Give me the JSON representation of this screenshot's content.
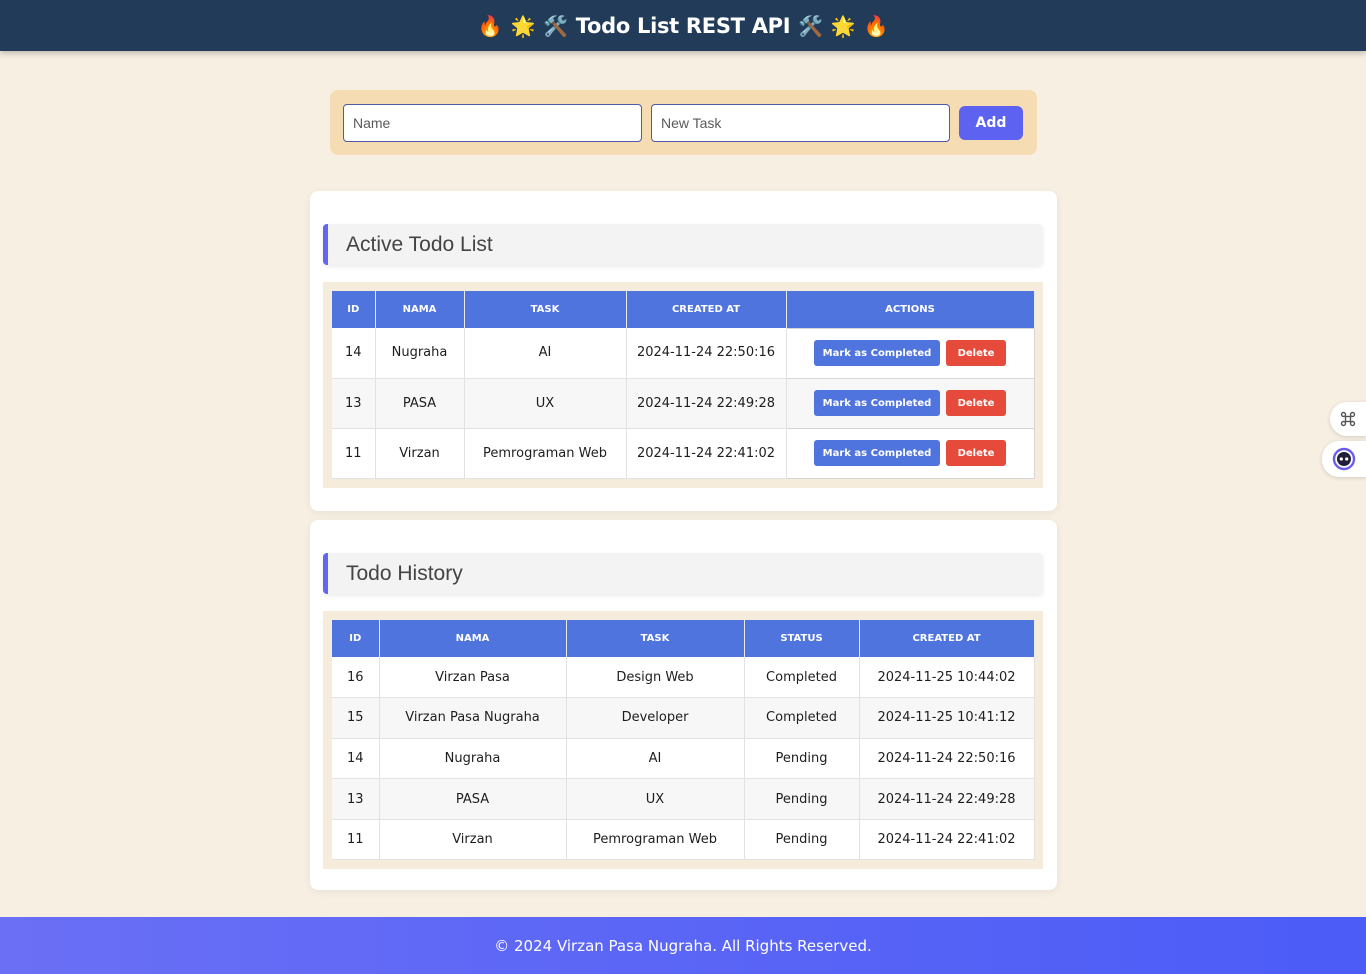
{
  "header": {
    "title": "Todo List REST API",
    "left_emojis": [
      "🔥",
      "🌟",
      "🛠️"
    ],
    "right_emojis": [
      "🛠️",
      "🌟",
      "🔥"
    ]
  },
  "form": {
    "name_placeholder": "Name",
    "task_placeholder": "New Task",
    "add_label": "Add"
  },
  "active": {
    "title": "Active Todo List",
    "columns": [
      "ID",
      "NAMA",
      "TASK",
      "CREATED AT",
      "ACTIONS"
    ],
    "complete_label": "Mark as Completed",
    "delete_label": "Delete",
    "rows": [
      {
        "id": "14",
        "nama": "Nugraha",
        "task": "AI",
        "created_at": "2024-11-24 22:50:16"
      },
      {
        "id": "13",
        "nama": "PASA",
        "task": "UX",
        "created_at": "2024-11-24 22:49:28"
      },
      {
        "id": "11",
        "nama": "Virzan",
        "task": "Pemrograman Web",
        "created_at": "2024-11-24 22:41:02"
      }
    ]
  },
  "history": {
    "title": "Todo History",
    "columns": [
      "ID",
      "NAMA",
      "TASK",
      "STATUS",
      "CREATED AT"
    ],
    "rows": [
      {
        "id": "16",
        "nama": "Virzan Pasa",
        "task": "Design Web",
        "status": "Completed",
        "created_at": "2024-11-25 10:44:02"
      },
      {
        "id": "15",
        "nama": "Virzan Pasa Nugraha",
        "task": "Developer",
        "status": "Completed",
        "created_at": "2024-11-25 10:41:12"
      },
      {
        "id": "14",
        "nama": "Nugraha",
        "task": "AI",
        "status": "Pending",
        "created_at": "2024-11-24 22:50:16"
      },
      {
        "id": "13",
        "nama": "PASA",
        "task": "UX",
        "status": "Pending",
        "created_at": "2024-11-24 22:49:28"
      },
      {
        "id": "11",
        "nama": "Virzan",
        "task": "Pemrograman Web",
        "status": "Pending",
        "created_at": "2024-11-24 22:41:02"
      }
    ]
  },
  "side_widgets": [
    "command-icon",
    "assistant-bot-icon"
  ],
  "footer": {
    "text": "© 2024 Virzan Pasa Nugraha. All Rights Reserved."
  },
  "colors": {
    "navbar": "#213b59",
    "accent": "#6366f1",
    "table_header": "#4f74de",
    "delete": "#e64a3b",
    "page_bg": "#f6efe2"
  }
}
